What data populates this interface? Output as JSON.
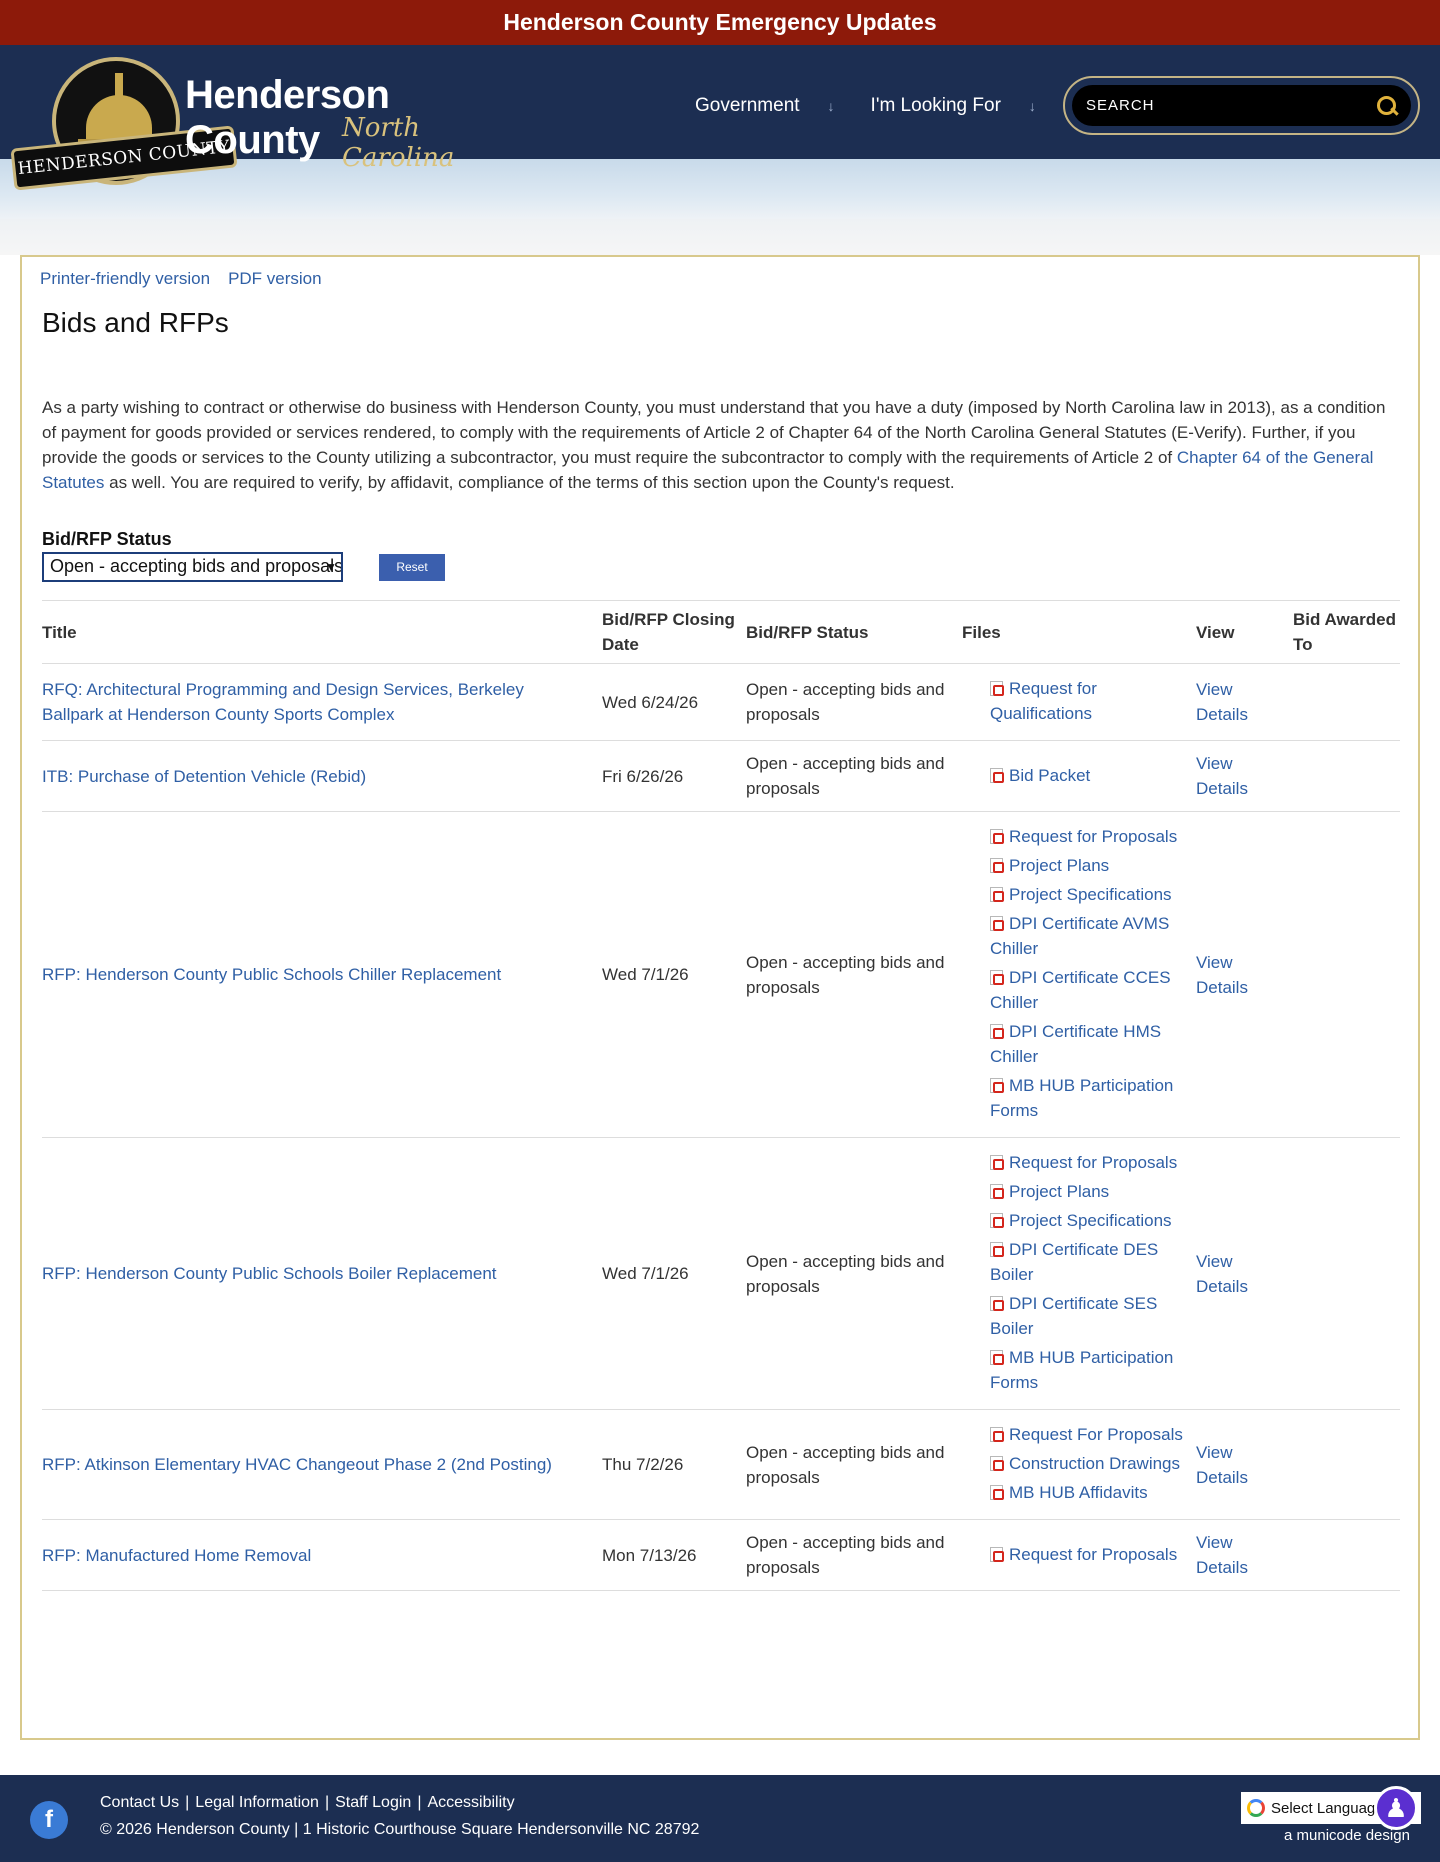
{
  "alert": {
    "text": "Henderson County Emergency Updates"
  },
  "logo": {
    "ribbon_text": "HENDERSON COUNTY",
    "county": "Henderson County",
    "state": "North Carolina"
  },
  "nav": {
    "items": [
      {
        "label": "Government"
      },
      {
        "label": "I'm Looking For"
      }
    ]
  },
  "search": {
    "placeholder": "SEARCH"
  },
  "util_links": {
    "printer": "Printer-friendly version",
    "pdf": "PDF version"
  },
  "page": {
    "title": "Bids and RFPs",
    "intro_before_link": "As a party wishing to contract or otherwise do business with Henderson County, you must understand that you have a duty (imposed by North Carolina law in 2013), as a condition of payment for goods provided or services rendered, to comply with the requirements of Article 2 of Chapter 64 of the North Carolina General Statutes (E-Verify). Further, if you provide the goods or services to the County utilizing a subcontractor, you must require the subcontractor to comply with the requirements of Article 2 of",
    "intro_link": "Chapter 64 of the General Statutes",
    "intro_after_link": "as well. You are required to verify, by affidavit, compliance of the terms of this section upon the County's request."
  },
  "filter": {
    "label": "Bid/RFP Status",
    "selected": "Open - accepting bids and proposals",
    "reset_label": "Reset"
  },
  "table": {
    "headers": {
      "title": "Title",
      "closing": "Bid/RFP Closing Date",
      "status": "Bid/RFP Status",
      "files": "Files",
      "view": "View",
      "awarded": "Bid Awarded To"
    },
    "rows": [
      {
        "title": "RFQ: Architectural Programming and Design Services, Berkeley Ballpark at Henderson County Sports Complex",
        "date": "Wed 6/24/26",
        "status": "Open - accepting bids and proposals",
        "files": [
          "Request for Qualifications"
        ],
        "view": "View Details",
        "awarded": ""
      },
      {
        "title": "ITB: Purchase of Detention Vehicle (Rebid)",
        "date": "Fri 6/26/26",
        "status": "Open - accepting bids and proposals",
        "files": [
          "Bid Packet"
        ],
        "view": "View Details",
        "awarded": ""
      },
      {
        "title": "RFP: Henderson County Public Schools Chiller Replacement",
        "date": "Wed 7/1/26",
        "status": "Open - accepting bids and proposals",
        "files": [
          "Request for Proposals",
          "Project Plans",
          "Project Specifications",
          "DPI Certificate AVMS Chiller",
          "DPI Certificate CCES Chiller",
          "DPI Certificate HMS Chiller",
          "MB HUB Participation Forms"
        ],
        "view": "View Details",
        "awarded": ""
      },
      {
        "title": "RFP: Henderson County Public Schools Boiler Replacement",
        "date": "Wed 7/1/26",
        "status": "Open - accepting bids and proposals",
        "files": [
          "Request for Proposals",
          "Project Plans",
          "Project Specifications",
          "DPI Certificate DES Boiler",
          "DPI Certificate SES Boiler",
          "MB HUB Participation Forms"
        ],
        "view": "View Details",
        "awarded": ""
      },
      {
        "title": "RFP: Atkinson Elementary HVAC Changeout Phase 2 (2nd Posting)",
        "date": "Thu 7/2/26",
        "status": "Open - accepting bids and proposals",
        "files": [
          "Request For Proposals",
          "Construction Drawings",
          "MB HUB Affidavits"
        ],
        "view": "View Details",
        "awarded": ""
      },
      {
        "title": "RFP: Manufactured Home Removal",
        "date": "Mon 7/13/26",
        "status": "Open - accepting bids and proposals",
        "files": [
          "Request for Proposals"
        ],
        "view": "View Details",
        "awarded": ""
      }
    ]
  },
  "footer": {
    "links": [
      "Contact Us",
      "Legal Information",
      "Staff Login",
      "Accessibility"
    ],
    "separator": "|",
    "copyright": "© 2026 Henderson County | 1 Historic Courthouse Square Hendersonville NC 28792",
    "translate_label": "Select Language",
    "credit": "a municode design",
    "facebook_glyph": "f"
  },
  "icons": {
    "search": "search-icon",
    "pdf": "pdf-file-icon",
    "facebook": "facebook-icon",
    "accessibility": "accessibility-icon",
    "chevron": "chevron-down-icon"
  },
  "colors": {
    "alert_bg": "#8d1a0a",
    "header_bg": "#1c2e52",
    "link": "#2f5fa5",
    "accent_gold": "#d8c98c",
    "reset_button": "#3b5fae"
  }
}
